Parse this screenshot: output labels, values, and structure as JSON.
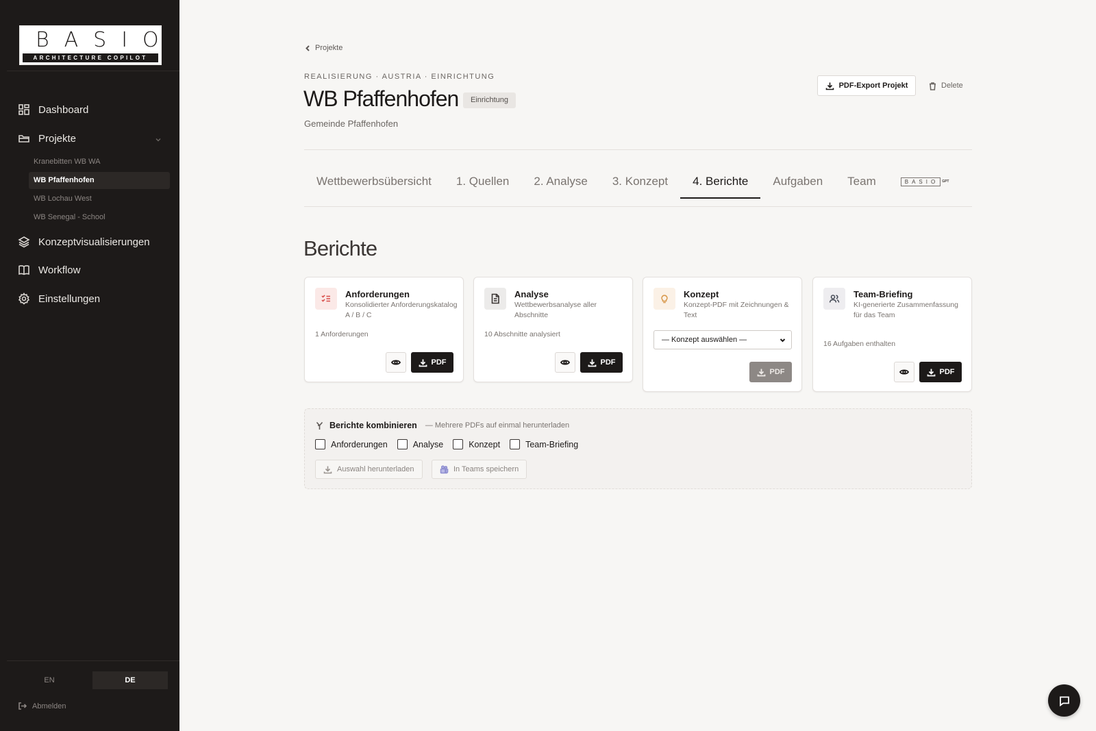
{
  "sidebar": {
    "logo": {
      "main": "BASIO",
      "tagline": "ARCHITECTURE COPILOT"
    },
    "nav": [
      {
        "label": "Dashboard",
        "icon": "grid-icon"
      },
      {
        "label": "Projekte",
        "icon": "folder-icon"
      },
      {
        "label": "Konzeptvisualisierungen",
        "icon": "layers-icon"
      },
      {
        "label": "Workflow",
        "icon": "book-icon"
      },
      {
        "label": "Einstellungen",
        "icon": "gear-icon"
      }
    ],
    "projects": [
      {
        "label": "Kranebitten WB WA",
        "active": false
      },
      {
        "label": "WB Pfaffenhofen",
        "active": true
      },
      {
        "label": "WB Lochau West",
        "active": false
      },
      {
        "label": "WB Senegal - School",
        "active": false
      }
    ],
    "languages": [
      {
        "label": "EN",
        "active": false
      },
      {
        "label": "DE",
        "active": true
      }
    ],
    "logout": "Abmelden"
  },
  "header": {
    "back": "Projekte",
    "crumb": "REALISIERUNG · AUSTRIA · EINRICHTUNG",
    "title": "WB Pfaffenhofen",
    "badge": "Einrichtung",
    "subtitle": "Gemeinde Pfaffenhofen",
    "export_button": "PDF-Export Projekt",
    "delete_button": "Delete"
  },
  "tabs": [
    {
      "label": "Wettbewerbsübersicht",
      "active": false
    },
    {
      "label": "1. Quellen",
      "active": false
    },
    {
      "label": "2. Analyse",
      "active": false
    },
    {
      "label": "3. Konzept",
      "active": false
    },
    {
      "label": "4. Berichte",
      "active": true
    },
    {
      "label": "Aufgaben",
      "active": false
    },
    {
      "label": "Team",
      "active": false
    }
  ],
  "tab_logo": {
    "box": "BASIO",
    "suffix": "GPT"
  },
  "section_title": "Berichte",
  "cards": [
    {
      "title": "Anforderungen",
      "desc": "Konsolidierter Anforderungskatalog A / B / C",
      "meta": "1 Anforderungen",
      "icon": "checklist-icon",
      "pdf": "PDF"
    },
    {
      "title": "Analyse",
      "desc": "Wettbewerbsanalyse aller Abschnitte",
      "meta": "10 Abschnitte analysiert",
      "icon": "document-icon",
      "pdf": "PDF"
    },
    {
      "title": "Konzept",
      "desc": "Konzept-PDF mit Zeichnungen & Text",
      "select": "— Konzept auswählen —",
      "icon": "lightbulb-icon",
      "pdf": "PDF"
    },
    {
      "title": "Team-Briefing",
      "desc": "KI-generierte Zusammenfassung für das Team",
      "meta": "16 Aufgaben enthalten",
      "icon": "users-icon",
      "pdf": "PDF"
    }
  ],
  "combine": {
    "title": "Berichte kombinieren",
    "subtitle": "— Mehrere PDFs auf einmal herunterladen",
    "options": [
      "Anforderungen",
      "Analyse",
      "Konzept",
      "Team-Briefing"
    ],
    "download_button": "Auswahl herunterladen",
    "teams_button": "In Teams speichern"
  },
  "colors": {
    "sidebar_bg": "#1d1a19",
    "page_bg": "#f7f6f4",
    "accent_dark": "#1d1a19",
    "icon_anforderungen": "#d9534f",
    "icon_konzept": "#d99a4e"
  }
}
